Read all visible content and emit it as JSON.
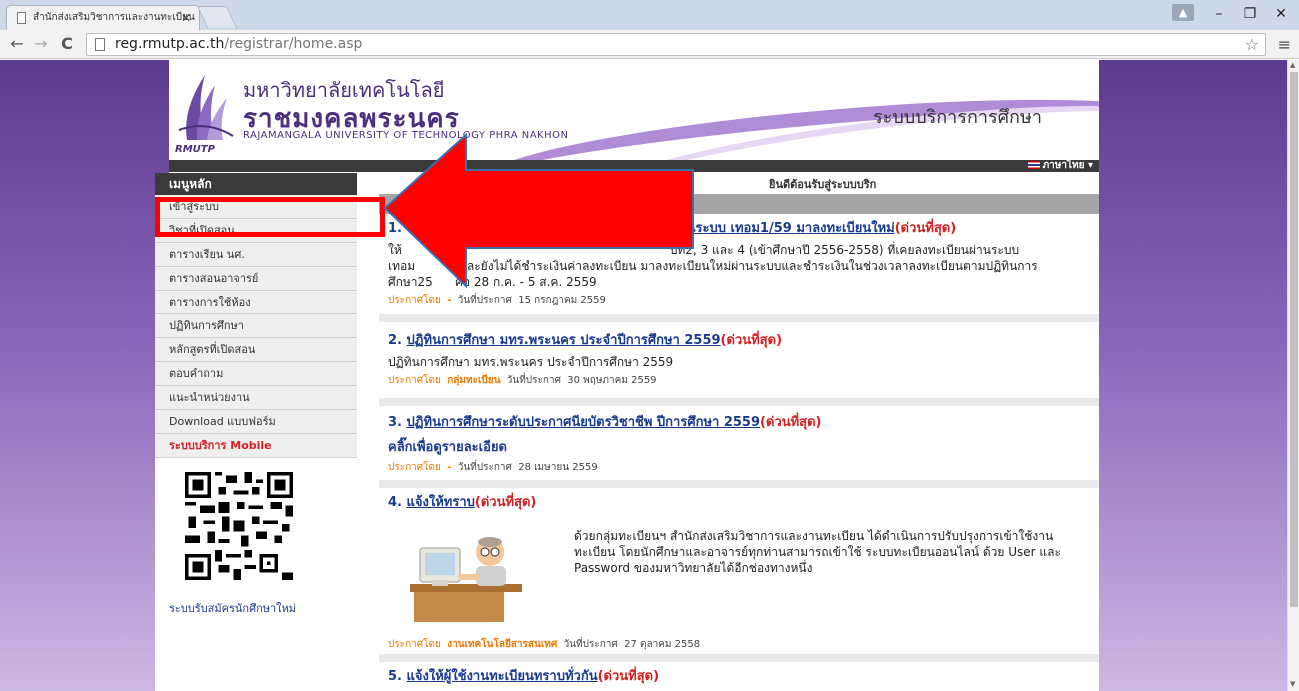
{
  "browser": {
    "tab_title": "สำนักส่งเสริมวิชาการและงานทะเบียน",
    "url_host": "reg.rmutp.ac.th",
    "url_path": "/registrar/home.asp"
  },
  "header": {
    "uni_th_line1": "มหาวิทยาลัยเทคโนโลยี",
    "uni_th_line2": "ราชมงคลพระนคร",
    "uni_en": "RAJAMANGALA UNIVERSITY OF TECHNOLOGY PHRA NAKHON",
    "logo_text": "RMUTP",
    "system_title": "ระบบบริการการศึกษา",
    "language": "ภาษาไทย ▾"
  },
  "sidebar": {
    "heading": "เมนูหลัก",
    "items": [
      {
        "label": "เข้าสู่ระบบ"
      },
      {
        "label": "วิชาที่เปิดสอน"
      },
      {
        "label": "ตารางเรียน นศ."
      },
      {
        "label": "ตารางสอนอาจารย์"
      },
      {
        "label": "ตารางการใช้ห้อง"
      },
      {
        "label": "ปฏิทินการศึกษา"
      },
      {
        "label": "หลักสูตรที่เปิดสอน"
      },
      {
        "label": "ตอบคำถาม"
      },
      {
        "label": "แนะนำหน่วยงาน"
      },
      {
        "label": "Download แบบฟอร์ม"
      },
      {
        "label": "ระบบบริการ Mobile"
      }
    ],
    "bottom_link": "ระบบรับสมัครนักศึกษาใหม่"
  },
  "main": {
    "welcome": "ยินดีต้อนรับสู่ระบบบริก",
    "news": [
      {
        "num": "1.",
        "title": "เบียนผ่านระบบ เทอม1/59 มาลงทะเบียนใหม่",
        "urgent": "(ด่วนที่สุด)",
        "body1": "ให้",
        "body1b": "ปีที่2, 3 และ 4 (เข้าศึกษาปี 2556-2558) ที่เคยลงทะเบียนผ่านระบบ",
        "body2": "เทอม",
        "body2b": "และยังไม่ได้ชำระเงินค่าลงทะเบียน มาลงทะเบียนใหม่ผ่านระบบและชำระเงินในช่วงเวลาลงทะเบียนตามปฏิทินการ",
        "body3": "ศึกษา25",
        "body3b": "คือ 28 ก.ค. - 5 ส.ค. 2559",
        "by_label": "ประกาศโดย",
        "by": "-",
        "date_label": "วันที่ประกาศ",
        "date": "15 กรกฎาคม 2559"
      },
      {
        "num": "2.",
        "title": "ปฏิทินการศึกษา มทร.พระนคร ประจำปีการศึกษา 2559",
        "urgent": "(ด่วนที่สุด)",
        "body": "ปฏิทินการศึกษา มทร.พระนคร ประจำปีการศึกษา 2559",
        "by_label": "ประกาศโดย",
        "by": "กลุ่มทะเบียน",
        "date_label": "วันที่ประกาศ",
        "date": "30 พฤษภาคม 2559"
      },
      {
        "num": "3.",
        "title": "ปฏิทินการศึกษาระดับประกาศนียบัตรวิชาชีพ ปีการศึกษา 2559",
        "urgent": "(ด่วนที่สุด)",
        "body": "คลิ๊กเพื่อดูรายละเอียด",
        "by_label": "ประกาศโดย",
        "by": "-",
        "date_label": "วันที่ประกาศ",
        "date": "28 เมษายน 2559"
      },
      {
        "num": "4.",
        "title": "แจ้งให้ทราบ",
        "urgent": "(ด่วนที่สุด)",
        "body": "ด้วยกลุ่มทะเบียนฯ สำนักส่งเสริมวิชาการและงานทะเบียน ได้ดำเนินการปรับปรุงการเข้าใช้งานทะเบียน โดยนักศึกษาและอาจารย์ทุกท่านสามารถเข้าใช้ ระบบทะเบียนออนไลน์ ด้วย User และ Password ของมหาวิทยาลัยได้อีกช่องทางหนึ่ง",
        "by_label": "ประกาศโดย",
        "by": "งานเทคโนโลยีสารสนเทศ",
        "date_label": "วันที่ประกาศ",
        "date": "27 ตุลาคม 2558"
      },
      {
        "num": "5.",
        "title": "แจ้งให้ผู้ใช้งานทะเบียนทราบทั่วกัน",
        "urgent": "(ด่วนที่สุด)"
      }
    ]
  },
  "colors": {
    "background_purple": "#6a479b",
    "annotation_red": "#ff0000",
    "link_blue": "#1a3c8f",
    "urgent_red": "#d42020",
    "meta_orange": "#f07a00"
  }
}
